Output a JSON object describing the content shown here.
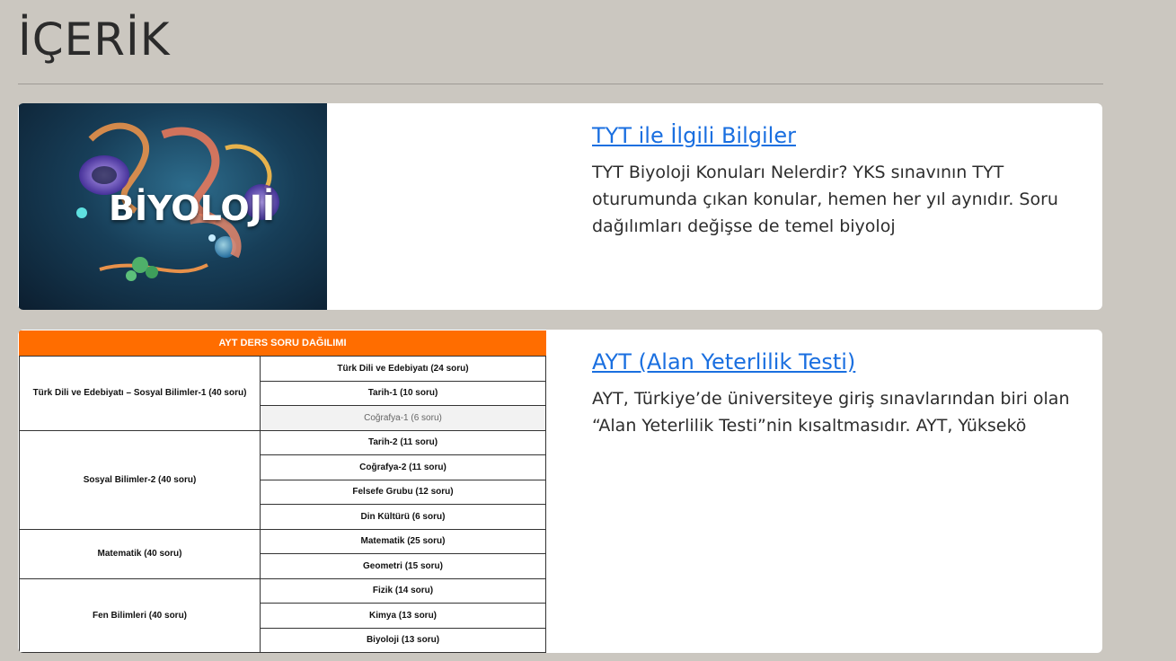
{
  "page": {
    "title": "İÇERİK"
  },
  "cards": [
    {
      "title": "TYT ile İlgili Bilgiler",
      "excerpt": "TYT Biyoloji Konuları Nelerdir? YKS sınavının TYT oturumunda çıkan konular, hemen her yıl aynıdır. Soru dağılımları değişse de temel biyoloj",
      "image": {
        "word": "BİYOLOJİ"
      }
    },
    {
      "title": "AYT (Alan Yeterlilik Testi)",
      "excerpt": "AYT, Türkiye’de üniversiteye giriş sınavlarından biri olan “Alan Yeterlilik Testi”nin kısaltmasıdır. AYT, Yüksekö",
      "table": {
        "header": "AYT DERS SORU DAĞILIMI",
        "groups": [
          {
            "name": "Türk Dili ve Edebiyatı – Sosyal Bilimler-1 (40 soru)",
            "rows": [
              "Türk Dili ve Edebiyatı (24 soru)",
              "Tarih-1 (10 soru)",
              "Coğrafya-1 (6 soru)"
            ]
          },
          {
            "name": "Sosyal Bilimler-2 (40 soru)",
            "rows": [
              "Tarih-2 (11 soru)",
              "Coğrafya-2 (11 soru)",
              "Felsefe Grubu (12 soru)",
              "Din Kültürü (6 soru)"
            ]
          },
          {
            "name": "Matematik (40 soru)",
            "rows": [
              "Matematik (25 soru)",
              "Geometri (15 soru)"
            ]
          },
          {
            "name": "Fen Bilimleri (40 soru)",
            "rows": [
              "Fizik (14 soru)",
              "Kimya (13 soru)",
              "Biyoloji (13 soru)"
            ]
          }
        ]
      }
    }
  ],
  "colors": {
    "background": "#cbc7c0",
    "link": "#1a6fe0",
    "table_header": "#ff6d00"
  }
}
